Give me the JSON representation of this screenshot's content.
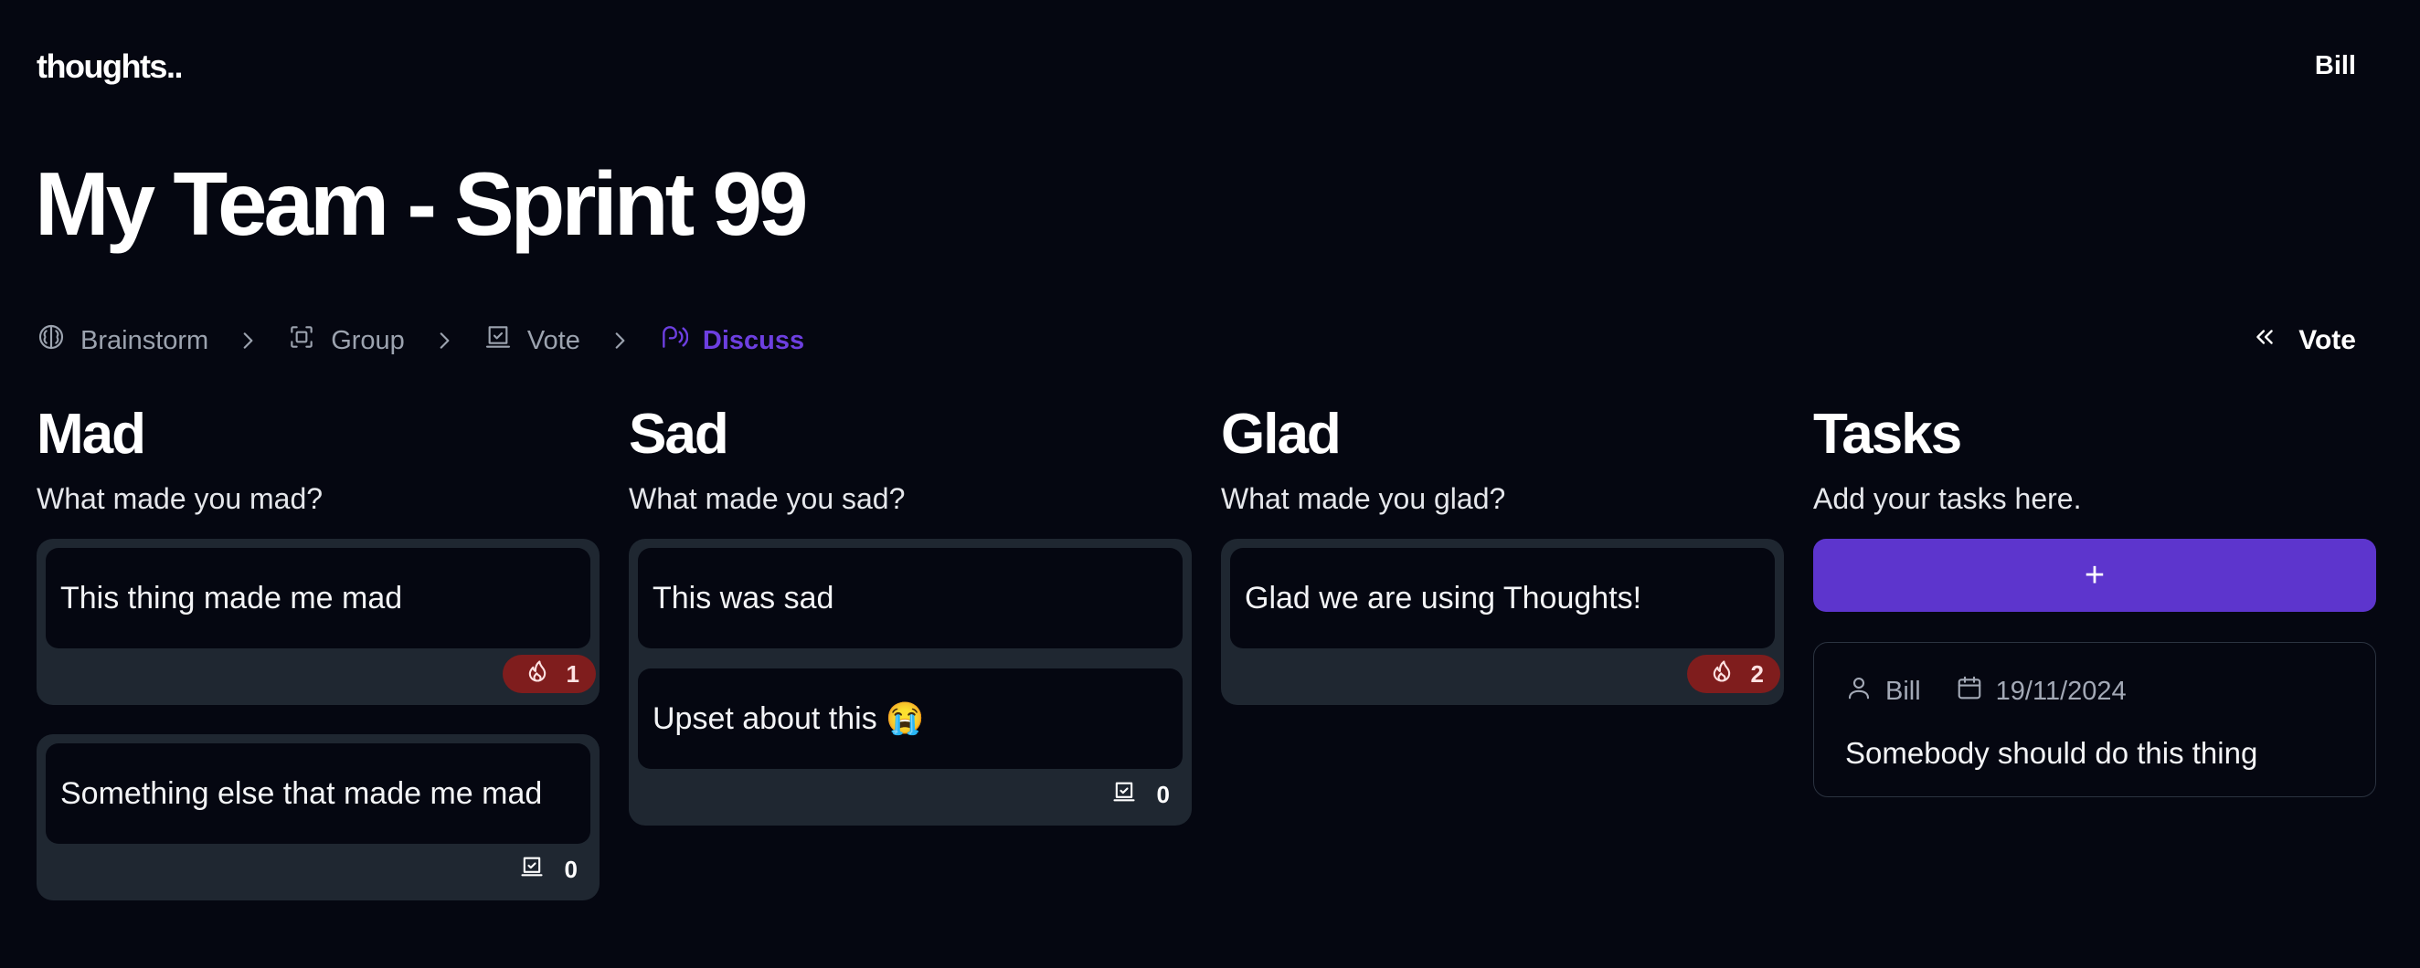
{
  "app": {
    "logo": "thoughts..",
    "user": "Bill"
  },
  "page": {
    "title": "My Team - Sprint 99"
  },
  "steps": [
    {
      "label": "Brainstorm",
      "icon": "brain-icon",
      "active": false
    },
    {
      "label": "Group",
      "icon": "group-icon",
      "active": false
    },
    {
      "label": "Vote",
      "icon": "vote-icon",
      "active": false
    },
    {
      "label": "Discuss",
      "icon": "discuss-icon",
      "active": true
    }
  ],
  "nav": {
    "back_label": "Vote"
  },
  "columns": {
    "mad": {
      "title": "Mad",
      "subtitle": "What made you mad?",
      "groups": [
        {
          "cards": [
            "This thing made me mad"
          ],
          "badge": {
            "type": "fire",
            "count": "1"
          }
        },
        {
          "cards": [
            "Something else that made me mad"
          ],
          "badge": {
            "type": "vote",
            "count": "0"
          }
        }
      ]
    },
    "sad": {
      "title": "Sad",
      "subtitle": "What made you sad?",
      "groups": [
        {
          "cards": [
            "This was sad",
            "Upset about this 😭"
          ],
          "badge": {
            "type": "vote",
            "count": "0"
          }
        }
      ]
    },
    "glad": {
      "title": "Glad",
      "subtitle": "What made you glad?",
      "groups": [
        {
          "cards": [
            "Glad we are using Thoughts!"
          ],
          "badge": {
            "type": "fire",
            "count": "2"
          }
        }
      ]
    },
    "tasks": {
      "title": "Tasks",
      "subtitle": "Add your tasks here.",
      "add_label": "+",
      "items": [
        {
          "assignee": "Bill",
          "date": "19/11/2024",
          "text": "Somebody should do this thing"
        }
      ]
    }
  },
  "colors": {
    "accent": "#5d35cd",
    "active_step": "#6d3fe0",
    "fire_badge": "#7f1d1d",
    "background": "#050711",
    "group_bg": "#1f2731"
  }
}
